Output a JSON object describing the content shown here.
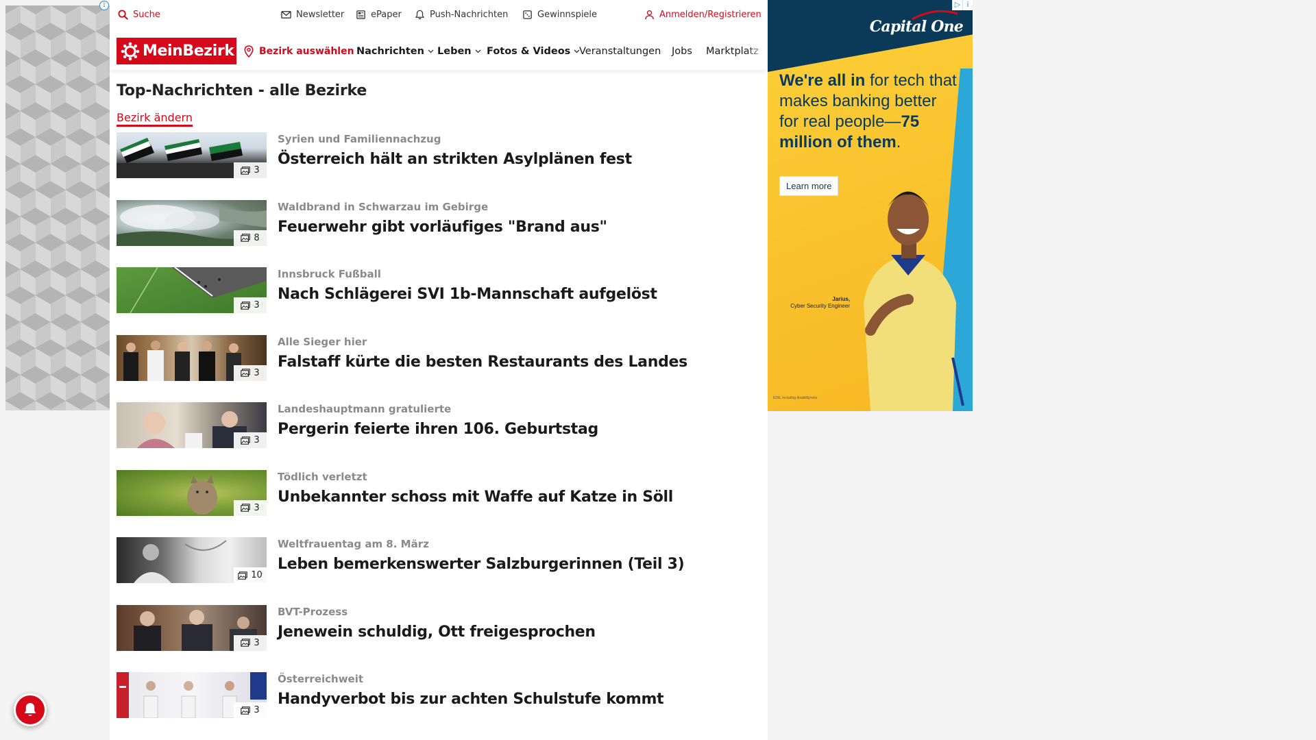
{
  "utility_bar": {
    "search_label": "Suche",
    "newsletter_label": "Newsletter",
    "epaper_label": "ePaper",
    "push_label": "Push-Nachrichten",
    "gewinnspiele_label": "Gewinnspiele",
    "login_label": "Anmelden/Registrieren"
  },
  "nav": {
    "logo_text": "MeinBezirk",
    "bezirk_select_label": "Bezirk auswählen",
    "items": [
      {
        "label": "Nachrichten",
        "has_dropdown": true
      },
      {
        "label": "Leben",
        "has_dropdown": true
      },
      {
        "label": "Fotos & Videos",
        "has_dropdown": true
      },
      {
        "label": "Veranstaltungen",
        "has_dropdown": false
      },
      {
        "label": "Jobs",
        "has_dropdown": false
      },
      {
        "label": "Marktplatz",
        "has_dropdown": false
      }
    ]
  },
  "main": {
    "title": "Top-Nachrichten - alle Bezirke",
    "change_link": "Bezirk ändern",
    "articles": [
      {
        "kicker": "Syrien und Familiennachzug",
        "headline": "Österreich hält an strikten Asylplänen fest",
        "photo_count": "3"
      },
      {
        "kicker": "Waldbrand in Schwarzau im Gebirge",
        "headline": "Feuerwehr gibt vorläufiges \"Brand aus\"",
        "photo_count": "8"
      },
      {
        "kicker": "Innsbruck Fußball",
        "headline": "Nach Schlägerei SVI 1b-Mannschaft aufgelöst",
        "photo_count": "3"
      },
      {
        "kicker": "Alle Sieger hier",
        "headline": "Falstaff kürte die besten Restaurants des Landes",
        "photo_count": "3"
      },
      {
        "kicker": "Landeshauptmann gratulierte",
        "headline": "Pergerin feierte ihren 106. Geburtstag",
        "photo_count": "3"
      },
      {
        "kicker": "Tödlich verletzt",
        "headline": "Unbekannter schoss mit Waffe auf Katze in Söll",
        "photo_count": "3"
      },
      {
        "kicker": "Weltfrauentag am 8. März",
        "headline": "Leben bemerkenswerter Salzburgerinnen (Teil 3)",
        "photo_count": "10"
      },
      {
        "kicker": "BVT-Prozess",
        "headline": "Jenewein schuldig, Ott freigesprochen",
        "photo_count": "3"
      },
      {
        "kicker": "Österreichweit",
        "headline": "Handyverbot bis zur achten Schulstufe kommt",
        "photo_count": "3"
      }
    ]
  },
  "ad_right": {
    "brand": "Capital One",
    "copy_bold_1": "We're all in",
    "copy_1": " for tech that makes banking better for real people—",
    "copy_bold_2": "75 million of them",
    "copy_2": ".",
    "button_label": "Learn more",
    "caption_name": "Jarius,",
    "caption_role": "Cyber Security Engineer",
    "fine_print": "EOE, including disability/vets"
  },
  "colors": {
    "brand_red": "#d6091b",
    "ad_navy": "#0b3a58",
    "ad_yellow": "#fcd03a",
    "ad_blue": "#2ba8d8"
  },
  "icons": {
    "search": "search-icon",
    "newsletter": "mail-icon",
    "epaper": "newspaper-icon",
    "push": "bell-icon",
    "gewinnspiele": "gift-icon",
    "login": "user-icon",
    "bezirk": "location-pin-icon",
    "photo_badge": "image-icon",
    "push_fab": "bell-icon"
  }
}
